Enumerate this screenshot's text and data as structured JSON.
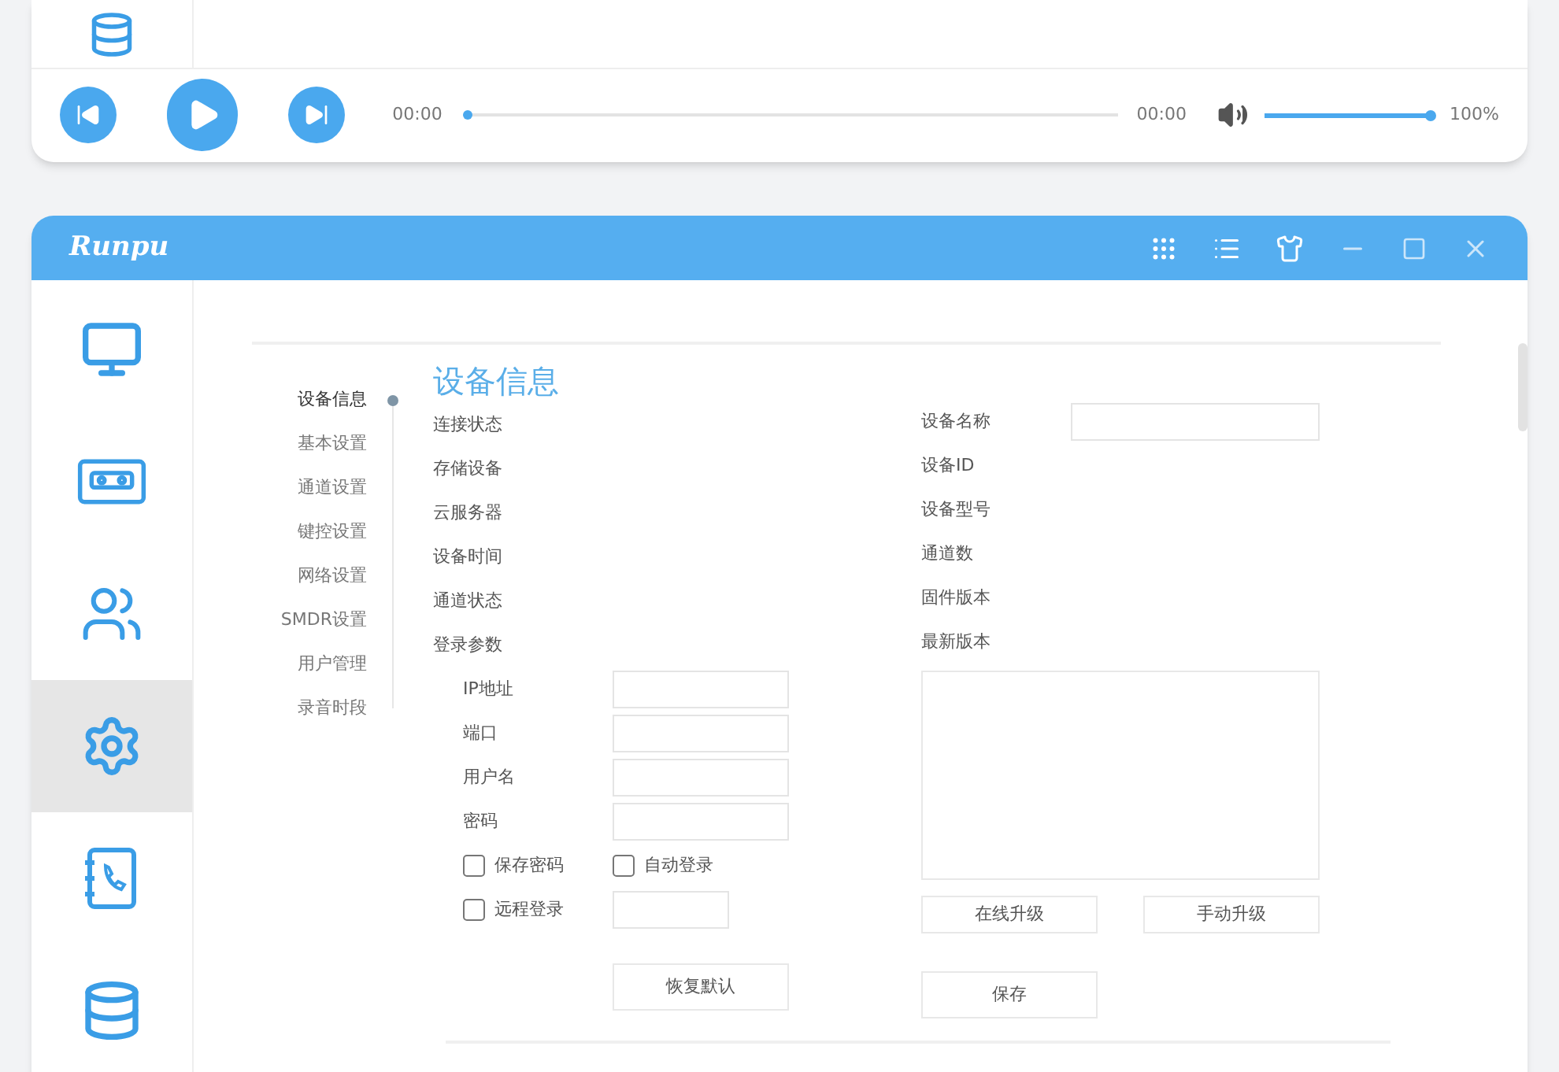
{
  "top_window": {
    "sidebar": [
      {
        "selected": false
      }
    ],
    "player": {
      "elapsed": "00:00",
      "progress": {
        "level": 0
      },
      "duration": "00:00",
      "volume": {
        "level": 1
      },
      "volume_reading": "100%"
    }
  },
  "window": {
    "logo": "Runpu",
    "sidebar": [
      {
        "selected": false
      },
      {
        "selected": false
      },
      {
        "selected": false
      },
      {
        "selected": true
      },
      {
        "selected": false
      },
      {
        "selected": false
      }
    ],
    "settings_nav": [
      {
        "label": "设备信息",
        "selected": true
      },
      {
        "label": "基本设置",
        "selected": false
      },
      {
        "label": "通道设置",
        "selected": false
      },
      {
        "label": "键控设置",
        "selected": false
      },
      {
        "label": "网络设置",
        "selected": false
      },
      {
        "label": "SMDR设置",
        "selected": false
      },
      {
        "label": "用户管理",
        "selected": false
      },
      {
        "label": "录音时段",
        "selected": false
      }
    ],
    "title": "设备信息",
    "left_labels": [
      "连接状态",
      "存储设备",
      "云服务器",
      "设备时间",
      "通道状态",
      "登录参数"
    ],
    "login_fields": [
      {
        "label": "IP地址"
      },
      {
        "label": "端口"
      },
      {
        "label": "用户名"
      },
      {
        "label": "密码"
      }
    ],
    "checkboxes": [
      {
        "label": "保存密码",
        "checked": false
      },
      {
        "label": "自动登录",
        "checked": false
      },
      {
        "label": "远程登录",
        "checked": false
      }
    ],
    "restore_button": "恢复默认",
    "right_labels": [
      "设备名称",
      "设备ID",
      "设备型号",
      "通道数",
      "固件版本",
      "最新版本"
    ],
    "upgrade_buttons": [
      "在线升级",
      "手动升级"
    ],
    "save_button": "保存"
  }
}
